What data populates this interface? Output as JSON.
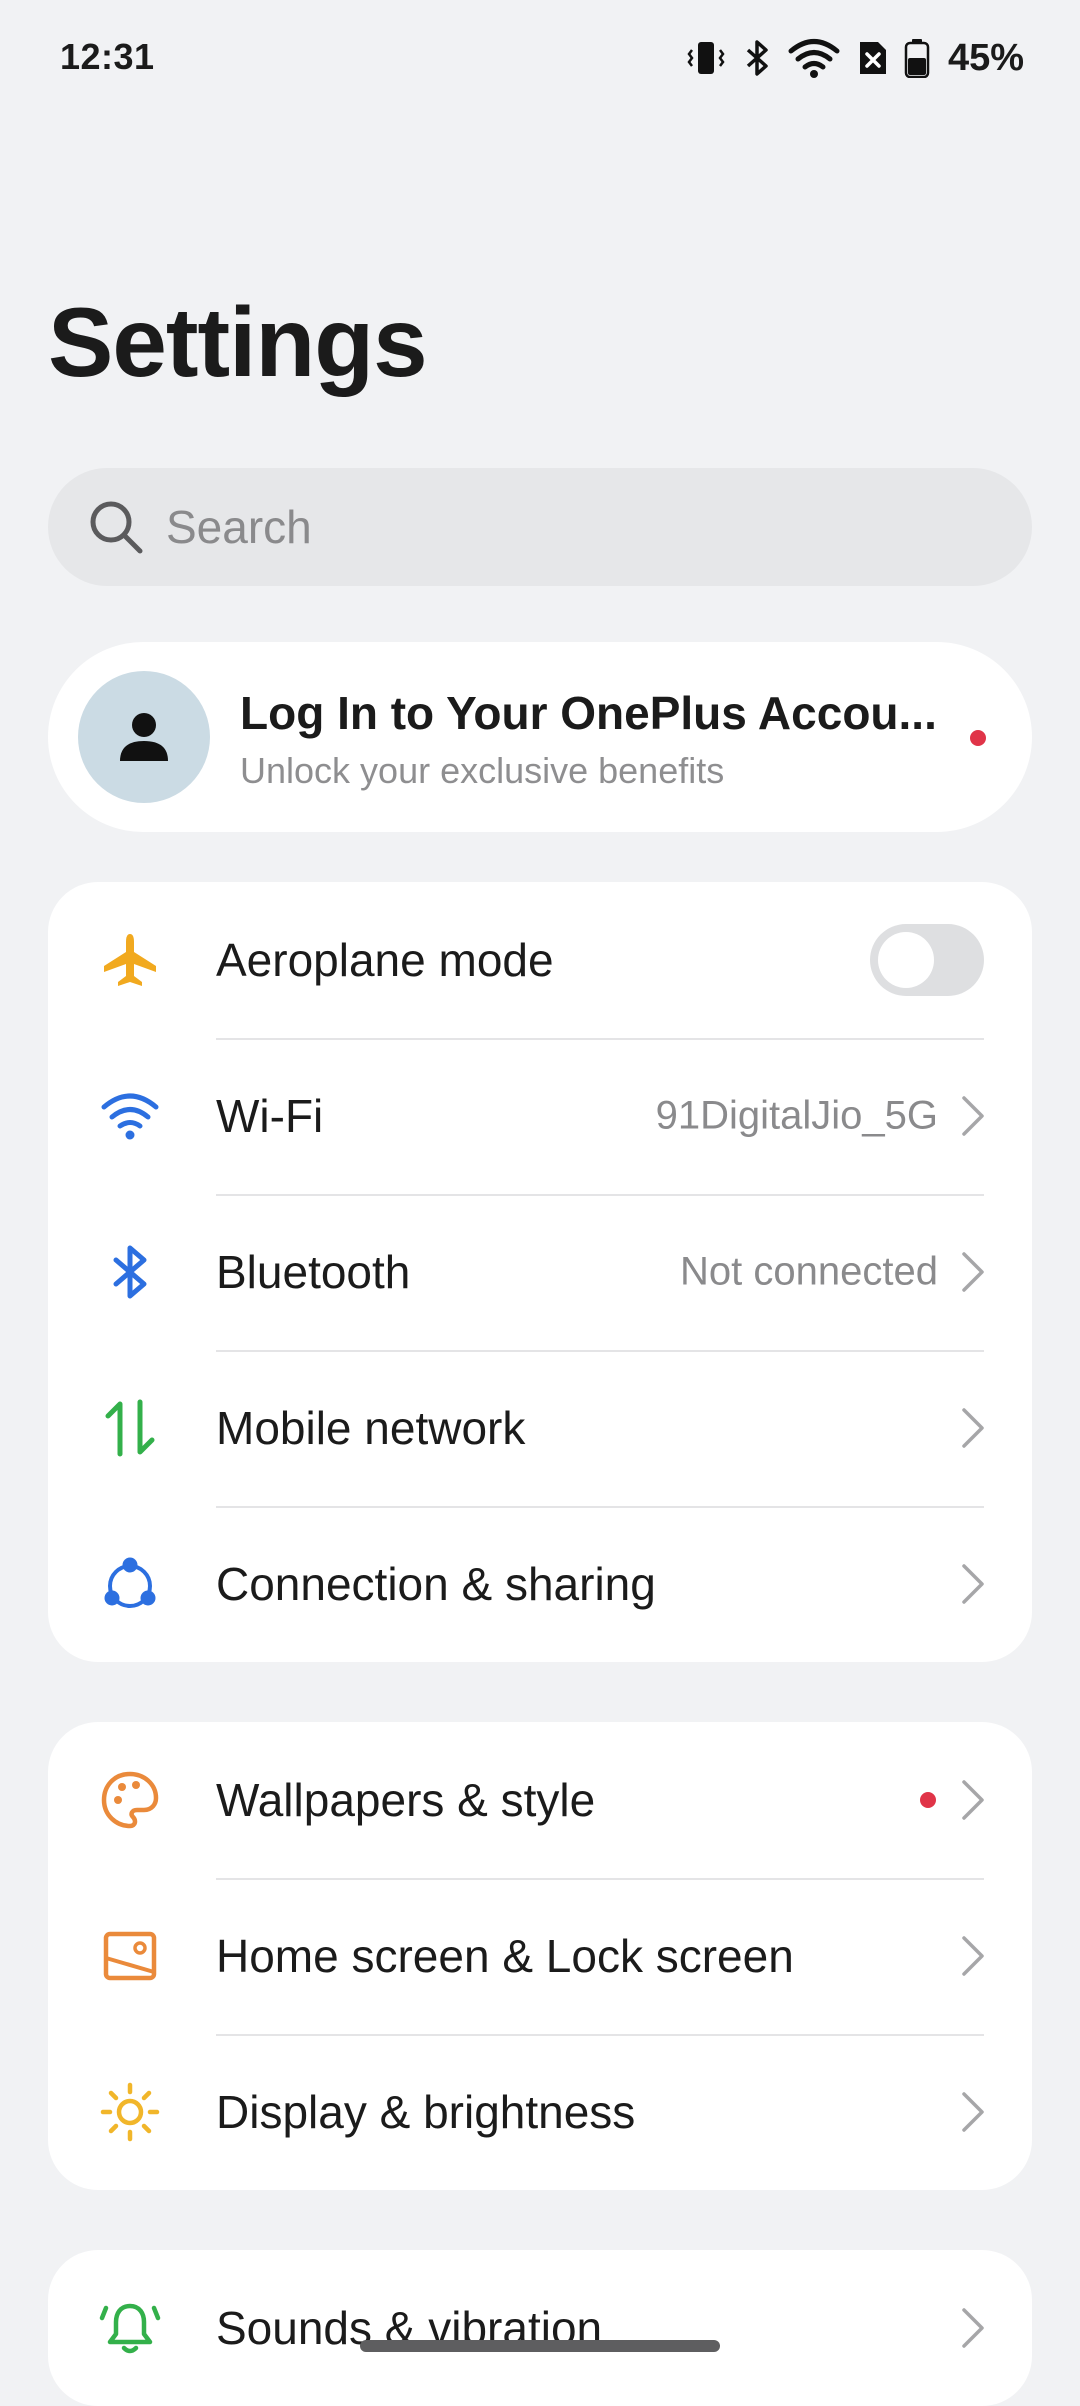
{
  "status_bar": {
    "time": "12:31",
    "battery": "45%",
    "icons": [
      "vibrate-icon",
      "bluetooth-icon",
      "wifi-icon",
      "no-sim-icon",
      "battery-icon"
    ]
  },
  "title": "Settings",
  "search": {
    "placeholder": "Search"
  },
  "account": {
    "title": "Log In to Your OnePlus Accou...",
    "subtitle": "Unlock your exclusive benefits",
    "icon": "person-icon",
    "has_notification": true
  },
  "groups": [
    {
      "items": [
        {
          "label": "Aeroplane mode",
          "icon": "airplane-icon",
          "icon_color": "#f1a91f",
          "type": "toggle",
          "toggle_on": false
        },
        {
          "label": "Wi-Fi",
          "value": "91DigitalJio_5G",
          "icon": "wifi-icon",
          "icon_color": "#2c6fe0",
          "type": "nav"
        },
        {
          "label": "Bluetooth",
          "value": "Not connected",
          "icon": "bluetooth-icon",
          "icon_color": "#2c6fe0",
          "type": "nav"
        },
        {
          "label": "Mobile network",
          "icon": "mobile-data-icon",
          "icon_color": "#33b04a",
          "type": "nav"
        },
        {
          "label": "Connection & sharing",
          "icon": "share-icon",
          "icon_color": "#2c6fe0",
          "type": "nav"
        }
      ]
    },
    {
      "items": [
        {
          "label": "Wallpapers & style",
          "icon": "palette-icon",
          "icon_color": "#ea8a3b",
          "type": "nav",
          "has_notification": true
        },
        {
          "label": "Home screen & Lock screen",
          "icon": "home-lock-icon",
          "icon_color": "#ea8a3b",
          "type": "nav"
        },
        {
          "label": "Display & brightness",
          "icon": "sun-icon",
          "icon_color": "#f1b62a",
          "type": "nav"
        }
      ]
    },
    {
      "items": [
        {
          "label": "Sounds & vibration",
          "icon": "bell-icon",
          "icon_color": "#33b04a",
          "type": "nav"
        }
      ]
    }
  ],
  "colors": {
    "background": "#f1f2f4",
    "card": "#ffffff",
    "notification_dot": "#e03448"
  }
}
